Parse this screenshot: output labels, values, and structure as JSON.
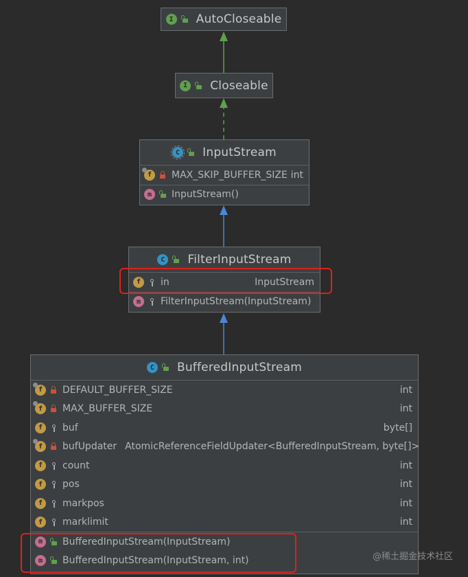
{
  "diagram": {
    "classes": {
      "autocloseable": {
        "kind": "I",
        "visibility": "public",
        "name": "AutoCloseable"
      },
      "closeable": {
        "kind": "I",
        "visibility": "public",
        "name": "Closeable"
      },
      "inputstream": {
        "kind": "C",
        "visibility": "public",
        "name": "InputStream",
        "abstract": true,
        "fields": [
          {
            "badge": "f",
            "static": true,
            "visibility": "private",
            "name": "MAX_SKIP_BUFFER_SIZE",
            "type": "int"
          }
        ],
        "methods": [
          {
            "badge": "m",
            "visibility": "public",
            "name": "InputStream()"
          }
        ]
      },
      "filterinputstream": {
        "kind": "C",
        "visibility": "public",
        "name": "FilterInputStream",
        "fields": [
          {
            "badge": "f",
            "visibility": "protected",
            "name": "in",
            "type": "InputStream"
          }
        ],
        "methods": [
          {
            "badge": "m",
            "visibility": "protected",
            "name": "FilterInputStream(InputStream)"
          }
        ]
      },
      "bufferedinputstream": {
        "kind": "C",
        "visibility": "public",
        "name": "BufferedInputStream",
        "fields": [
          {
            "badge": "f",
            "static": true,
            "visibility": "private",
            "name": "DEFAULT_BUFFER_SIZE",
            "type": "int"
          },
          {
            "badge": "f",
            "static": true,
            "visibility": "private",
            "name": "MAX_BUFFER_SIZE",
            "type": "int"
          },
          {
            "badge": "f",
            "visibility": "protected",
            "name": "buf",
            "type": "byte[]"
          },
          {
            "badge": "f",
            "static": true,
            "visibility": "private",
            "name": "bufUpdater",
            "type": "AtomicReferenceFieldUpdater<BufferedInputStream, byte[]>"
          },
          {
            "badge": "f",
            "visibility": "protected",
            "name": "count",
            "type": "int"
          },
          {
            "badge": "f",
            "visibility": "protected",
            "name": "pos",
            "type": "int"
          },
          {
            "badge": "f",
            "visibility": "protected",
            "name": "markpos",
            "type": "int"
          },
          {
            "badge": "f",
            "visibility": "protected",
            "name": "marklimit",
            "type": "int"
          }
        ],
        "methods": [
          {
            "badge": "m",
            "visibility": "public",
            "name": "BufferedInputStream(InputStream)"
          },
          {
            "badge": "m",
            "visibility": "public",
            "name": "BufferedInputStream(InputStream, int)"
          }
        ]
      }
    },
    "relations": [
      {
        "from": "closeable",
        "to": "autocloseable",
        "type": "extends"
      },
      {
        "from": "inputstream",
        "to": "closeable",
        "type": "implements"
      },
      {
        "from": "filterinputstream",
        "to": "inputstream",
        "type": "extends"
      },
      {
        "from": "bufferedinputstream",
        "to": "filterinputstream",
        "type": "extends"
      }
    ],
    "colors": {
      "interface_arrow": "#5fa04e",
      "class_arrow": "#4a88d6",
      "highlight": "#e0211a"
    }
  },
  "watermark": "@稀土掘金技术社区"
}
